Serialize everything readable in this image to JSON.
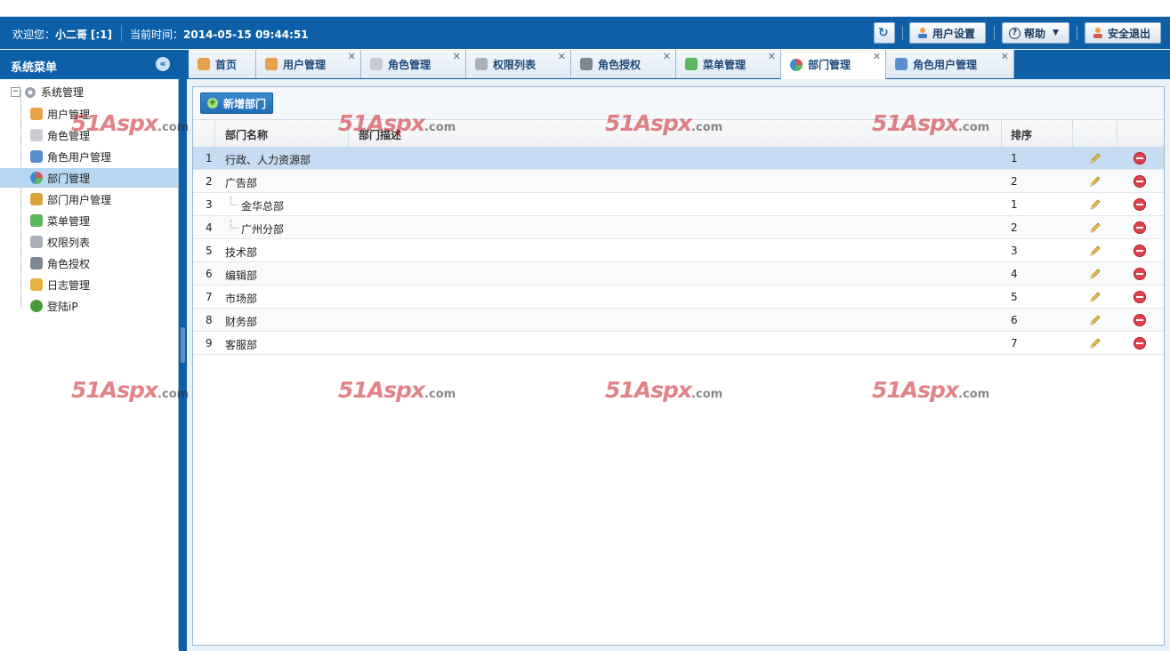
{
  "header": {
    "welcome_prefix": "欢迎您：",
    "user_name": "小二哥",
    "user_flag": "[:1]",
    "time_label": "当前时间：",
    "time_value": "2014-05-15 09:44:51",
    "user_settings": "用户设置",
    "help": "帮助",
    "logout": "安全退出"
  },
  "sidebar": {
    "title": "系统菜单",
    "root": "系统管理",
    "items": [
      {
        "label": "用户管理",
        "icon": "user-icon"
      },
      {
        "label": "角色管理",
        "icon": "database-icon"
      },
      {
        "label": "角色用户管理",
        "icon": "user-role-icon"
      },
      {
        "label": "部门管理",
        "icon": "pie-chart-icon"
      },
      {
        "label": "部门用户管理",
        "icon": "broom-icon"
      },
      {
        "label": "菜单管理",
        "icon": "sitemap-icon"
      },
      {
        "label": "权限列表",
        "icon": "pen-icon"
      },
      {
        "label": "角色授权",
        "icon": "anchor-icon"
      },
      {
        "label": "日志管理",
        "icon": "log-icon"
      },
      {
        "label": "登陆iP",
        "icon": "bug-icon"
      }
    ],
    "active_index": 3
  },
  "tabs": [
    {
      "label": "首页",
      "closable": false
    },
    {
      "label": "用户管理",
      "closable": true
    },
    {
      "label": "角色管理",
      "closable": true
    },
    {
      "label": "权限列表",
      "closable": true
    },
    {
      "label": "角色授权",
      "closable": true
    },
    {
      "label": "菜单管理",
      "closable": true
    },
    {
      "label": "部门管理",
      "closable": true
    },
    {
      "label": "角色用户管理",
      "closable": true
    }
  ],
  "active_tab": 6,
  "toolbar": {
    "add_label": "新增部门"
  },
  "table": {
    "columns": {
      "name": "部门名称",
      "desc": "部门描述",
      "sort": "排序"
    },
    "rows": [
      {
        "num": "1",
        "name": "行政、人力资源部",
        "sort": "1"
      },
      {
        "num": "2",
        "name": "广告部",
        "sort": "2"
      },
      {
        "num": "3",
        "name": "金华总部",
        "sort": "1"
      },
      {
        "num": "4",
        "name": "广州分部",
        "sort": "2"
      },
      {
        "num": "5",
        "name": "技术部",
        "sort": "3"
      },
      {
        "num": "6",
        "name": "编辑部",
        "sort": "4"
      },
      {
        "num": "7",
        "name": "市场部",
        "sort": "5"
      },
      {
        "num": "8",
        "name": "财务部",
        "sort": "6"
      },
      {
        "num": "9",
        "name": "客服部",
        "sort": "7"
      }
    ]
  },
  "watermark": {
    "main": "51Aspx",
    "suffix": ".com"
  },
  "colors": {
    "header_blue": "#0d5fa8",
    "selected_row": "#c5dcf2",
    "delete_red": "#e0404a"
  }
}
